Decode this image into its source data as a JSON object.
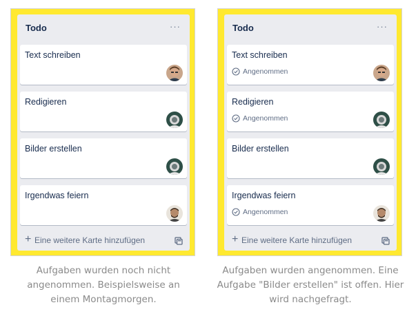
{
  "boards": [
    {
      "list_title": "Todo",
      "menu_label": "···",
      "add_card_label": "Eine weitere Karte hinzufügen",
      "cards": [
        {
          "title": "Text schreiben",
          "badge": "",
          "avatar": "person-1"
        },
        {
          "title": "Redigieren",
          "badge": "",
          "avatar": "person-2"
        },
        {
          "title": "Bilder erstellen",
          "badge": "",
          "avatar": "person-2"
        },
        {
          "title": "Irgendwas feiern",
          "badge": "",
          "avatar": "person-3"
        }
      ],
      "caption": [
        "Aufgaben wurden noch nicht",
        "angenommen. Beispielsweise an",
        "einem Montagmorgen."
      ]
    },
    {
      "list_title": "Todo",
      "menu_label": "···",
      "add_card_label": "Eine weitere Karte hinzufügen",
      "cards": [
        {
          "title": "Text schreiben",
          "badge": "Angenommen",
          "avatar": "person-1"
        },
        {
          "title": "Redigieren",
          "badge": "Angenommen",
          "avatar": "person-2"
        },
        {
          "title": "Bilder erstellen",
          "badge": "",
          "avatar": "person-2"
        },
        {
          "title": "Irgendwas feiern",
          "badge": "Angenommen",
          "avatar": "person-3"
        }
      ],
      "caption": [
        "Aufgaben wurden angenommen. Eine",
        "Aufgabe \"Bilder erstellen\" ist offen. Hier",
        "wird nachgefragt."
      ]
    }
  ],
  "colors": {
    "highlight": "#ffe930",
    "list_background": "#ebecf0",
    "text": "#172b4d",
    "muted": "#5e6c84",
    "caption": "#8a8a8a"
  },
  "icons": {
    "accepted": "check-circle-icon",
    "add": "plus-icon",
    "template": "card-template-icon",
    "menu": "more-icon"
  }
}
